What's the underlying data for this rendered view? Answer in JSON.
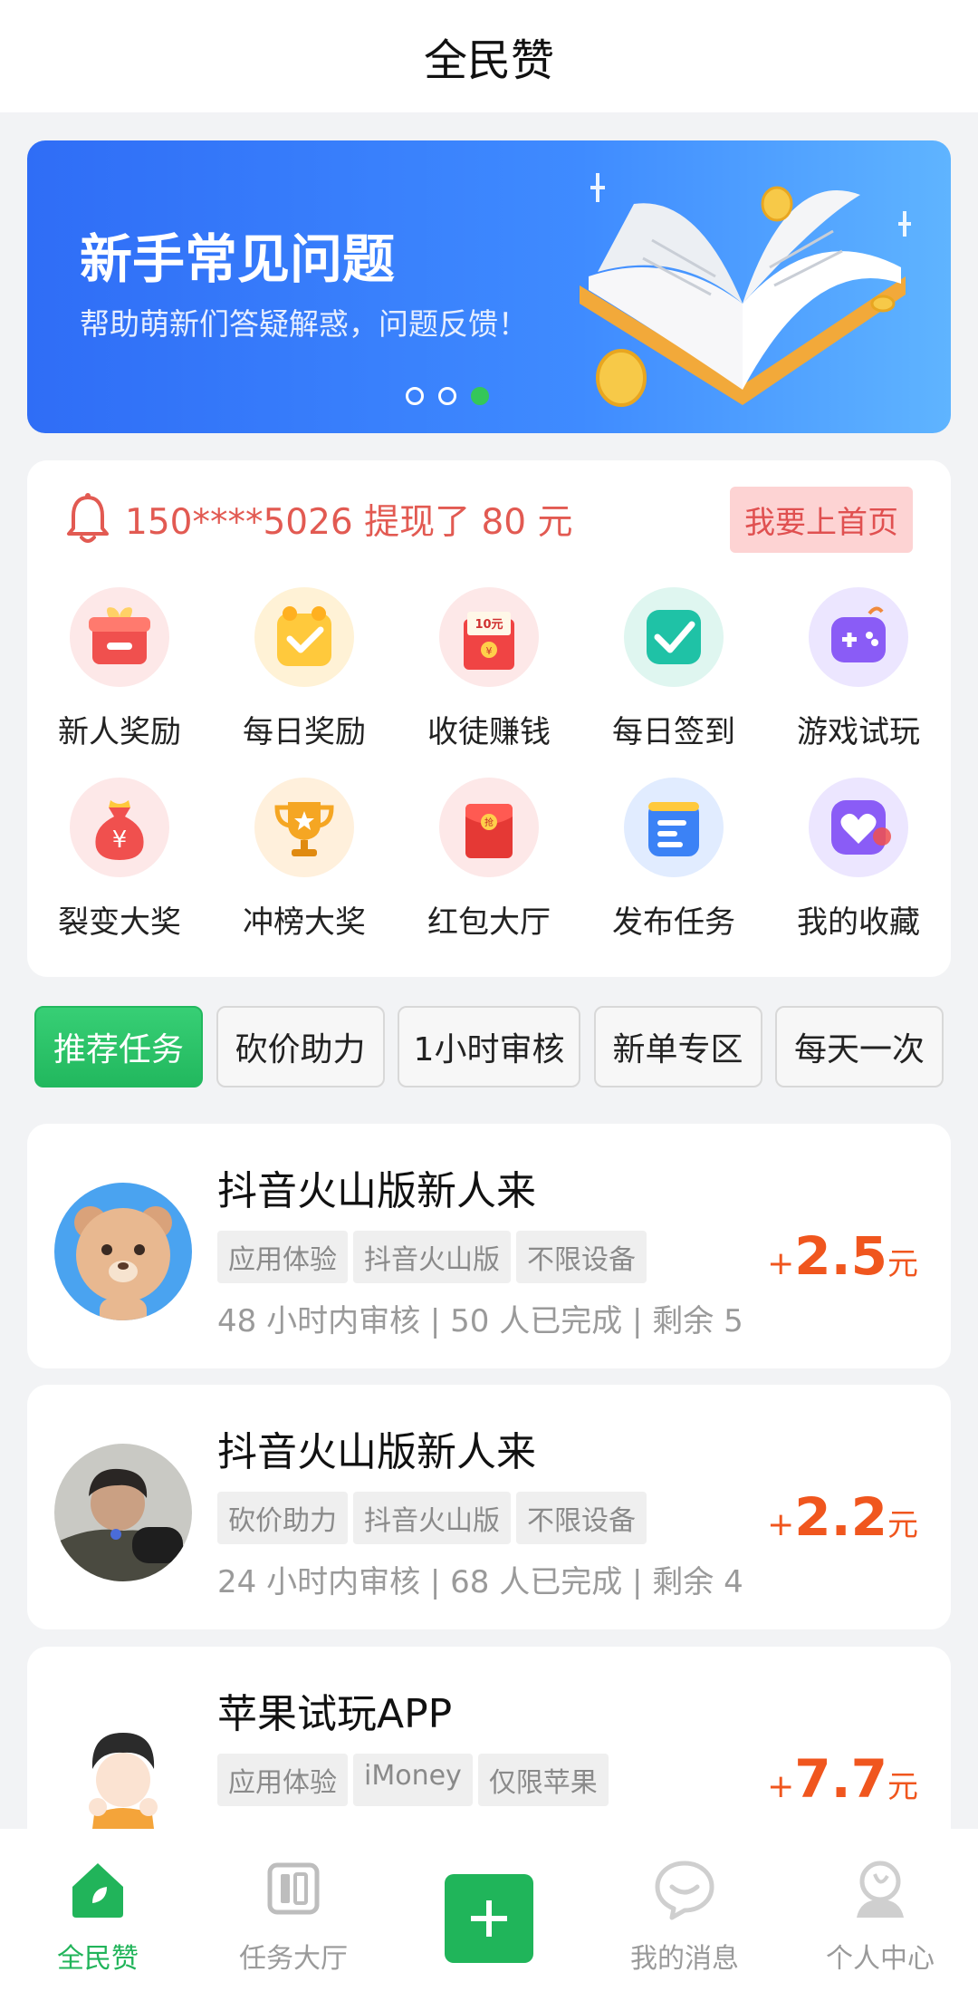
{
  "header": {
    "title": "全民赞"
  },
  "banner": {
    "title": "新手常见问题",
    "subtitle": "帮助萌新们答疑解惑，问题反馈！",
    "dots": 3,
    "active_dot": 2
  },
  "notice": {
    "text": "150****5026 提现了 80 元",
    "button": "我要上首页"
  },
  "features": [
    {
      "label": "新人奖励",
      "icon": "gift-box-icon"
    },
    {
      "label": "每日奖励",
      "icon": "check-gift-icon"
    },
    {
      "label": "收徒赚钱",
      "icon": "red-envelope-icon",
      "badge": "10元"
    },
    {
      "label": "每日签到",
      "icon": "checkbox-icon"
    },
    {
      "label": "游戏试玩",
      "icon": "gamepad-icon"
    },
    {
      "label": "裂变大奖",
      "icon": "money-bag-icon"
    },
    {
      "label": "冲榜大奖",
      "icon": "trophy-icon"
    },
    {
      "label": "红包大厅",
      "icon": "red-packet-icon",
      "badge": "抢"
    },
    {
      "label": "发布任务",
      "icon": "document-icon"
    },
    {
      "label": "我的收藏",
      "icon": "heart-icon"
    }
  ],
  "tabs": [
    "推荐任务",
    "砍价助力",
    "1小时审核",
    "新单专区",
    "每天一次"
  ],
  "active_tab": 0,
  "tasks": [
    {
      "title": "抖音火山版新人来",
      "tags": [
        "应用体验",
        "抖音火山版",
        "不限设备"
      ],
      "meta": "48 小时内审核 | 50 人已完成 | 剩余 5",
      "plus": "+",
      "reward": "2.5",
      "unit": "元",
      "avatar": "bear-avatar"
    },
    {
      "title": "抖音火山版新人来",
      "tags": [
        "砍价助力",
        "抖音火山版",
        "不限设备"
      ],
      "meta": "24 小时内审核 | 68 人已完成 | 剩余 4",
      "plus": "+",
      "reward": "2.2",
      "unit": "元",
      "avatar": "child-photo-avatar"
    },
    {
      "title": "苹果试玩APP",
      "tags": [
        "应用体验",
        "iMoney",
        "仅限苹果"
      ],
      "meta": "",
      "plus": "+",
      "reward": "7.7",
      "unit": "元",
      "avatar": "cartoon-boy-avatar"
    }
  ],
  "nav": [
    {
      "label": "全民赞",
      "icon": "home-icon",
      "active": true
    },
    {
      "label": "任务大厅",
      "icon": "task-hall-icon",
      "active": false
    },
    {
      "label": "",
      "icon": "plus-icon",
      "active": false
    },
    {
      "label": "我的消息",
      "icon": "message-icon",
      "active": false
    },
    {
      "label": "个人中心",
      "icon": "profile-icon",
      "active": false
    }
  ],
  "colors": {
    "brand_green": "#21b45a",
    "banner_blue": "#3f8bff",
    "reward_orange": "#f0561e",
    "notice_red": "#e25a52"
  }
}
